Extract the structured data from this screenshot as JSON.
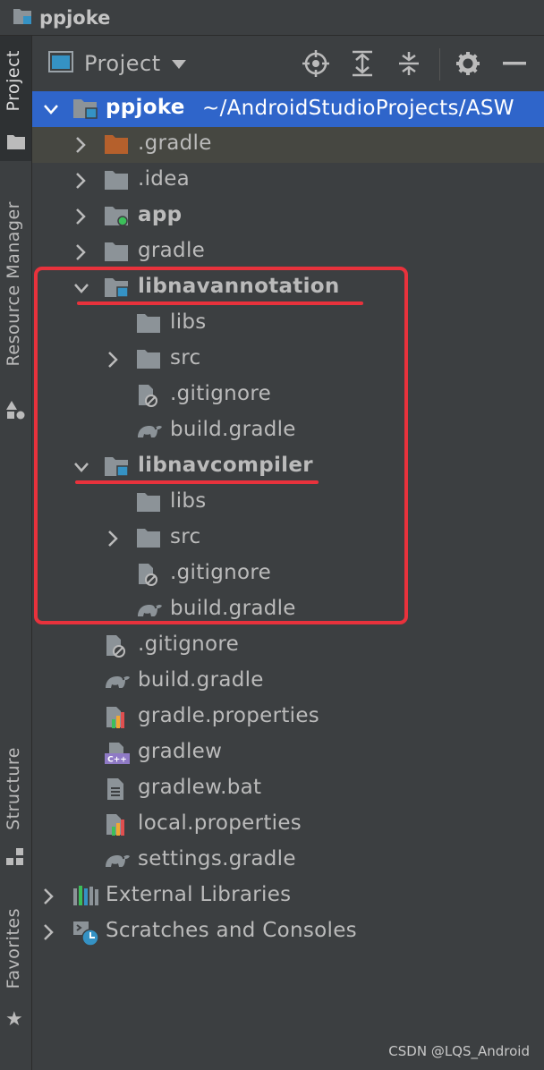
{
  "window": {
    "title": "ppjoke"
  },
  "sidebar": {
    "tabs": [
      {
        "label": "Project"
      },
      {
        "label": "Resource Manager"
      },
      {
        "label": "Structure"
      },
      {
        "label": "Favorites"
      }
    ]
  },
  "panel": {
    "view_label": "Project",
    "tool_icons": [
      "locate-icon",
      "expand-all-icon",
      "collapse-all-icon",
      "gear-icon",
      "hide-icon"
    ]
  },
  "tree": {
    "root": {
      "name": "ppjoke",
      "path": "~/AndroidStudioProjects/ASW"
    },
    "items": [
      {
        "label": ".gradle"
      },
      {
        "label": ".idea"
      },
      {
        "label": "app"
      },
      {
        "label": "gradle"
      },
      {
        "label": "libnavannotation"
      },
      {
        "label": "libs"
      },
      {
        "label": "src"
      },
      {
        "label": ".gitignore"
      },
      {
        "label": "build.gradle"
      },
      {
        "label": "libnavcompiler"
      },
      {
        "label": "libs"
      },
      {
        "label": "src"
      },
      {
        "label": ".gitignore"
      },
      {
        "label": "build.gradle"
      },
      {
        "label": ".gitignore"
      },
      {
        "label": "build.gradle"
      },
      {
        "label": "gradle.properties"
      },
      {
        "label": "gradlew"
      },
      {
        "label": "gradlew.bat"
      },
      {
        "label": "local.properties"
      },
      {
        "label": "settings.gradle"
      },
      {
        "label": "External Libraries"
      },
      {
        "label": "Scratches and Consoles"
      }
    ]
  },
  "watermark": "CSDN @LQS_Android",
  "colors": {
    "background": "#3c3f41",
    "selection": "#2f65ca",
    "highlight_box": "#e8323c",
    "folder": "#8c9398",
    "module_badge": "#3592c4"
  }
}
